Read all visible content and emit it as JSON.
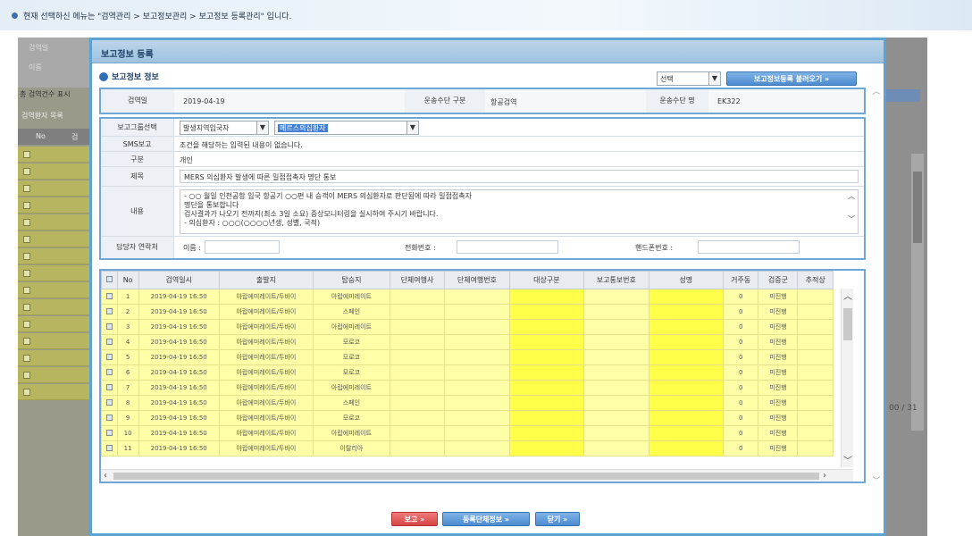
{
  "notice": "현재 선택하신 메뉴는 \"검역관리 > 보고정보관리 > 보고정보 등록관리\" 입니다.",
  "background": {
    "side_labels": [
      "검역일",
      "이름",
      "총 검역건수 표시",
      "검역환자 목록"
    ],
    "table_header": [
      "No",
      "검"
    ],
    "pager": "00 / 31"
  },
  "modal": {
    "title": "보고정보 등록",
    "section_title": "보고정보 정보",
    "select_value": "선택",
    "load_button": "보고정보등록 불러오기 »",
    "info": {
      "date_label": "검역일",
      "date_value": "2019-04-19",
      "transport_label": "운송수단 구분",
      "transport_value": "항공검역",
      "vehicle_label": "운송수단 명",
      "vehicle_value": "EK322"
    },
    "report": {
      "group_label": "보고그룹선택",
      "group_value": "발생지역입국자",
      "group_value2": "메르스의심환자",
      "sms_label": "SMS보고",
      "sms_value": "조건을 해당하는 입력된 내용이 없습니다.",
      "type_label": "구분",
      "type_value": "개인",
      "subject_label": "제목",
      "subject_value": "MERS 의심환자 발생에 따른 밀접접촉자 명단 통보",
      "content_label": "내용",
      "content_lines": [
        "- ○○ 월일 인천공항 입국 항공기 ○○편 내 승객이 MERS 의심환자로 판단됨에 따라 밀접접촉자",
        "  명단을 통보합니다",
        "  검사결과가 나오기 전까지(최소 3일 소요) 증상모니터링을 실시하여 주시기 바랍니다.",
        "- 의심환자 : ○○○(○○○○년생, 성별, 국적)"
      ],
      "contact_label": "담당자 연락처",
      "name_label": "이름 :",
      "phone_label": "전화번호 :",
      "mobile_label": "핸드폰번호 :"
    },
    "table": {
      "headers": [
        "No",
        "검역일시",
        "출발지",
        "탑승지",
        "단체여행사",
        "단체여행번호",
        "대상구분",
        "보고통보번호",
        "성명",
        "거주동",
        "검증군",
        "추적상"
      ],
      "rows": [
        {
          "no": "1",
          "date": "2019-04-19 16:50",
          "origin": "아랍에미레이트/두바이",
          "board": "아랍에미레이트"
        },
        {
          "no": "2",
          "date": "2019-04-19 16:50",
          "origin": "아랍에미레이트/두바이",
          "board": "스페인"
        },
        {
          "no": "3",
          "date": "2019-04-19 16:50",
          "origin": "아랍에미레이트/두바이",
          "board": "아랍에미레이트"
        },
        {
          "no": "4",
          "date": "2019-04-19 16:50",
          "origin": "아랍에미레이트/두바이",
          "board": "모로코"
        },
        {
          "no": "5",
          "date": "2019-04-19 16:50",
          "origin": "아랍에미레이트/두바이",
          "board": "모로코"
        },
        {
          "no": "6",
          "date": "2019-04-19 16:50",
          "origin": "아랍에미레이트/두바이",
          "board": "모로코"
        },
        {
          "no": "7",
          "date": "2019-04-19 16:50",
          "origin": "아랍에미레이트/두바이",
          "board": "아랍에미레이트"
        },
        {
          "no": "8",
          "date": "2019-04-19 16:50",
          "origin": "아랍에미레이트/두바이",
          "board": "스페인"
        },
        {
          "no": "9",
          "date": "2019-04-19 16:50",
          "origin": "아랍에미레이트/두바이",
          "board": "모로코"
        },
        {
          "no": "10",
          "date": "2019-04-19 16:50",
          "origin": "아랍에미레이트/두바이",
          "board": "아랍에미레이트"
        },
        {
          "no": "11",
          "date": "2019-04-19 16:50",
          "origin": "아랍에미레이트/두바이",
          "board": "이탈리아"
        }
      ],
      "residence": "0",
      "status": "미진행"
    },
    "buttons": {
      "report": "보고 »",
      "register_groups": "등록단체정보 »",
      "close": "닫기 »"
    }
  }
}
